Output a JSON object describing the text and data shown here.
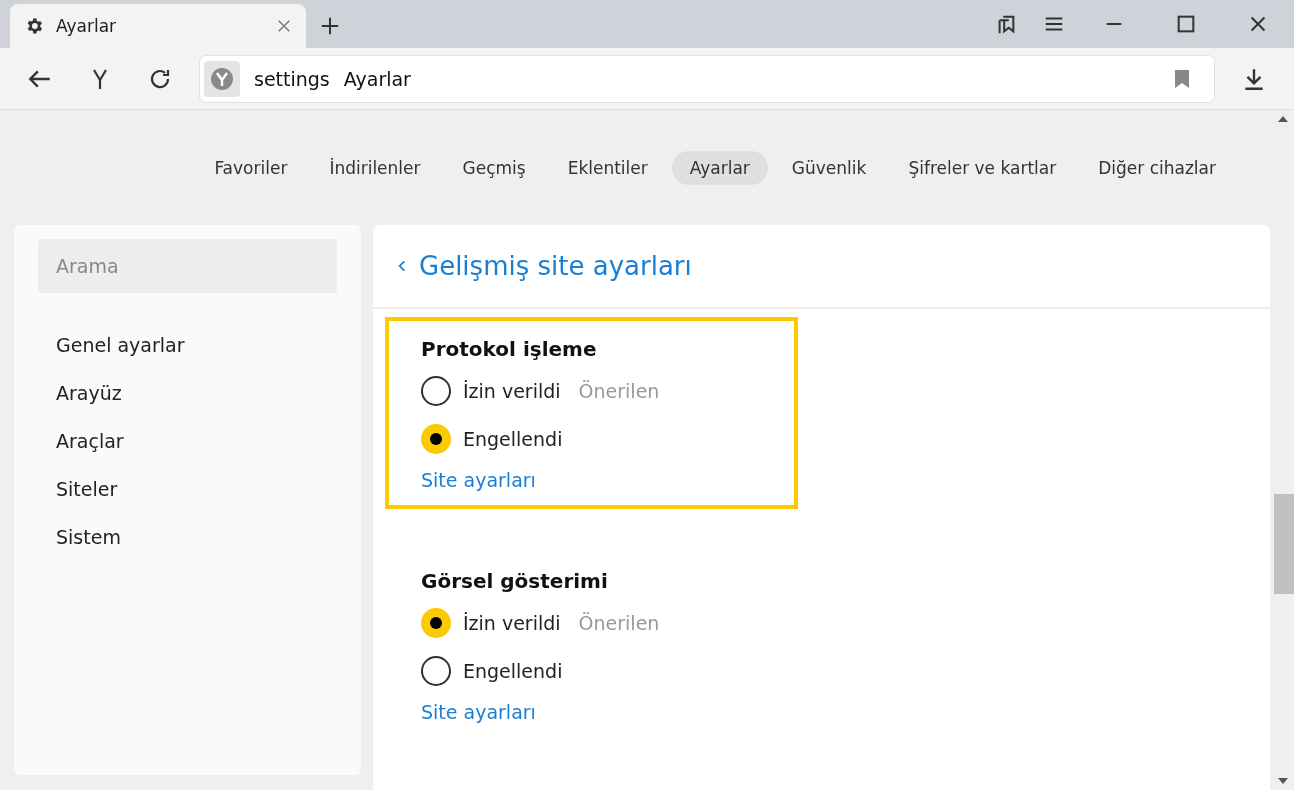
{
  "browser_tab": {
    "title": "Ayarlar"
  },
  "address_bar": {
    "url": "settings",
    "page_title": "Ayarlar"
  },
  "nav_tabs": [
    {
      "label": "Favoriler",
      "selected": false
    },
    {
      "label": "İndirilenler",
      "selected": false
    },
    {
      "label": "Geçmiş",
      "selected": false
    },
    {
      "label": "Eklentiler",
      "selected": false
    },
    {
      "label": "Ayarlar",
      "selected": true
    },
    {
      "label": "Güvenlik",
      "selected": false
    },
    {
      "label": "Şifreler ve kartlar",
      "selected": false
    },
    {
      "label": "Diğer cihazlar",
      "selected": false
    }
  ],
  "sidebar": {
    "search": {
      "placeholder": "Arama"
    },
    "items": [
      "Genel ayarlar",
      "Arayüz",
      "Araçlar",
      "Siteler",
      "Sistem"
    ]
  },
  "panel": {
    "title": "Gelişmiş site ayarları",
    "sections": [
      {
        "title": "Protokol işleme",
        "highlighted": true,
        "options": [
          {
            "label": "İzin verildi",
            "note": "Önerilen",
            "selected": false
          },
          {
            "label": "Engellendi",
            "selected": true
          }
        ],
        "link": "Site ayarları"
      },
      {
        "title": "Görsel gösterimi",
        "highlighted": false,
        "options": [
          {
            "label": "İzin verildi",
            "note": "Önerilen",
            "selected": true
          },
          {
            "label": "Engellendi",
            "selected": false
          }
        ],
        "link": "Site ayarları"
      }
    ]
  }
}
